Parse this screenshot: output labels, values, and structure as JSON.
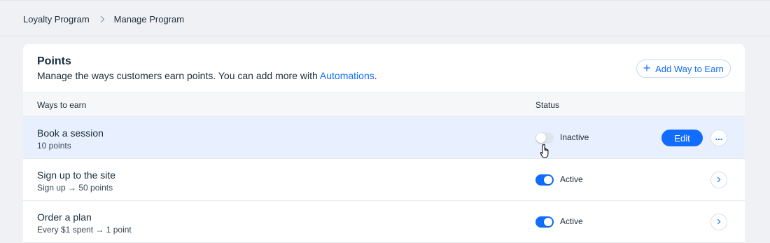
{
  "breadcrumb": {
    "items": [
      {
        "label": "Loyalty Program"
      },
      {
        "label": "Manage Program"
      }
    ]
  },
  "card": {
    "title": "Points",
    "subtitle_text": "Manage the ways customers earn points. You can add more with ",
    "subtitle_link": "Automations",
    "subtitle_end": ".",
    "add_button_label": "Add Way to Earn"
  },
  "table": {
    "columns": [
      "Ways to earn",
      "Status"
    ],
    "rows": [
      {
        "title": "Book a session",
        "subtitle": "10 points",
        "active": false,
        "status": "Inactive",
        "edit_label": "Edit"
      },
      {
        "title": "Sign up to the site",
        "subtitle": "Sign up → 50 points",
        "active": true,
        "status": "Active"
      },
      {
        "title": "Order a plan",
        "subtitle": "Every $1 spent → 1 point",
        "active": true,
        "status": "Active"
      }
    ]
  },
  "colors": {
    "accent": "#116dff",
    "hover_row": "#e8f0ff",
    "page_bg": "#eff1f5"
  }
}
